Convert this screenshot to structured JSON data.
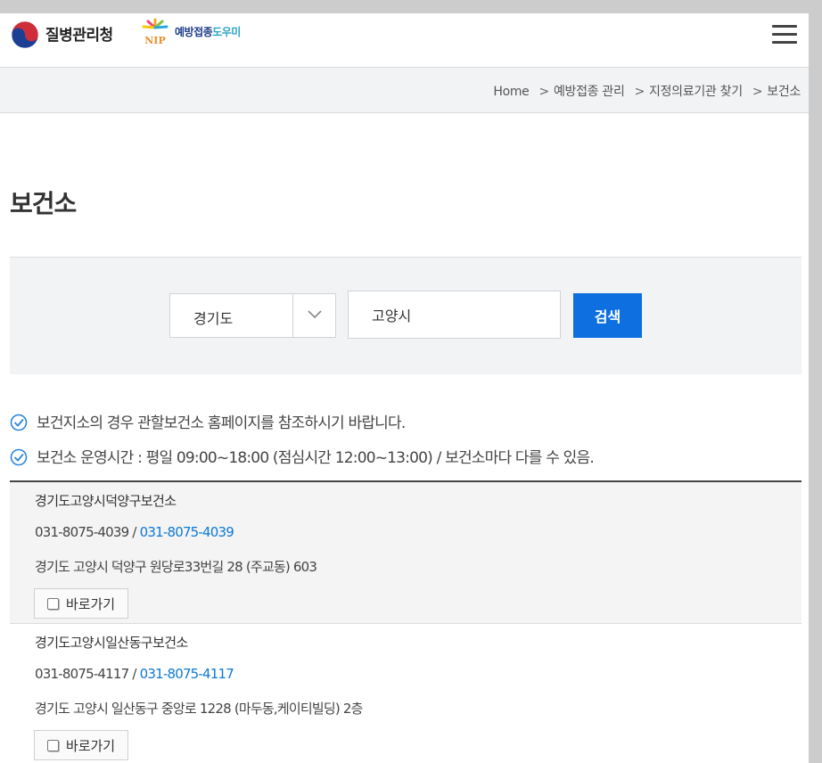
{
  "header": {
    "org_name": "질병관리청",
    "service_name_main": "예방접종",
    "service_name_tail": "도우미",
    "nip_logo_text": "NIP"
  },
  "breadcrumb": {
    "items": [
      "Home",
      "예방접종 관리",
      "지정의료기관 찾기",
      "보건소"
    ],
    "separator": ">"
  },
  "page": {
    "title": "보건소"
  },
  "search": {
    "region": "경기도",
    "city": "고양시",
    "button_label": "검색"
  },
  "notices": [
    "보건지소의 경우 관할보건소 홈페이지를 참조하시기 바랍니다.",
    "보건소 운영시간 : 평일 09:00~18:00 (점심시간 12:00~13:00) / 보건소마다 다를 수 있음."
  ],
  "results": [
    {
      "name": "경기도고양시덕양구보건소",
      "phone": "031-8075-4039",
      "phone_link": "031-8075-4039",
      "address": "경기도 고양시 덕양구 원당로33번길 28 (주교동) 603",
      "button_label": "바로가기"
    },
    {
      "name": "경기도고양시일산동구보건소",
      "phone": "031-8075-4117",
      "phone_link": "031-8075-4117",
      "address": "경기도 고양시 일산동구 중앙로 1228 (마두동,케이티빌딩) 2층",
      "button_label": "바로가기"
    }
  ],
  "colors": {
    "accent": "#0d6fe0",
    "link": "#0d79d6",
    "panel_bg": "#f2f3f5",
    "outer_bg": "#cccccc"
  }
}
